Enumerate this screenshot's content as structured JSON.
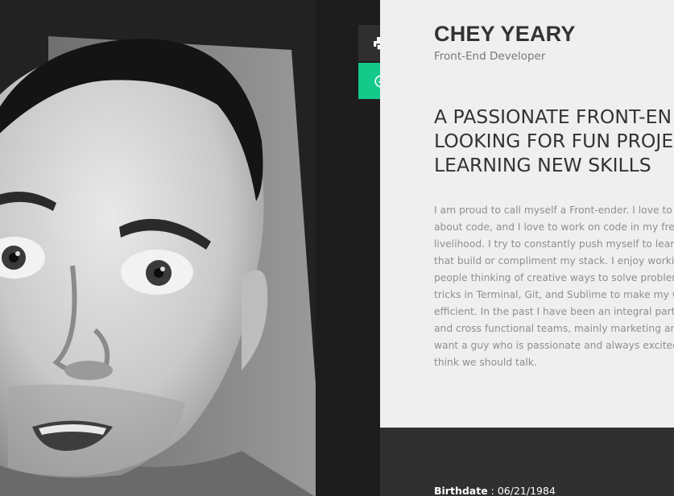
{
  "photo": {
    "alt": "portrait"
  },
  "actions": {
    "print_icon": "print-icon",
    "download_icon": "download-circle-icon",
    "download_color": "#14c98a"
  },
  "profile": {
    "name": "CHEY YEARY",
    "role": "Front-End Developer"
  },
  "headline": {
    "lines": [
      "A PASSIONATE FRONT-EN",
      "LOOKING FOR FUN PROJE",
      "LEARNING NEW SKILLS"
    ]
  },
  "bio": {
    "lines": [
      "I am proud to call myself a Front-ender. I love to co",
      "about code, and I love to work on code in my free t",
      "livelihood. I try to constantly push myself to learn",
      "that build or compliment my stack. I enjoy working",
      "people thinking of creative ways to solve problems",
      "tricks in Terminal, Git, and Sublime to make my wo",
      "efficient. In the past I have been an integral part fo",
      "and cross functional teams, mainly marketing and",
      "want a guy who is passionate and always excited t",
      "think we should talk."
    ]
  },
  "details": {
    "birthdate_label": "Birthdate",
    "birthdate_value": " : 06/21/1984"
  }
}
